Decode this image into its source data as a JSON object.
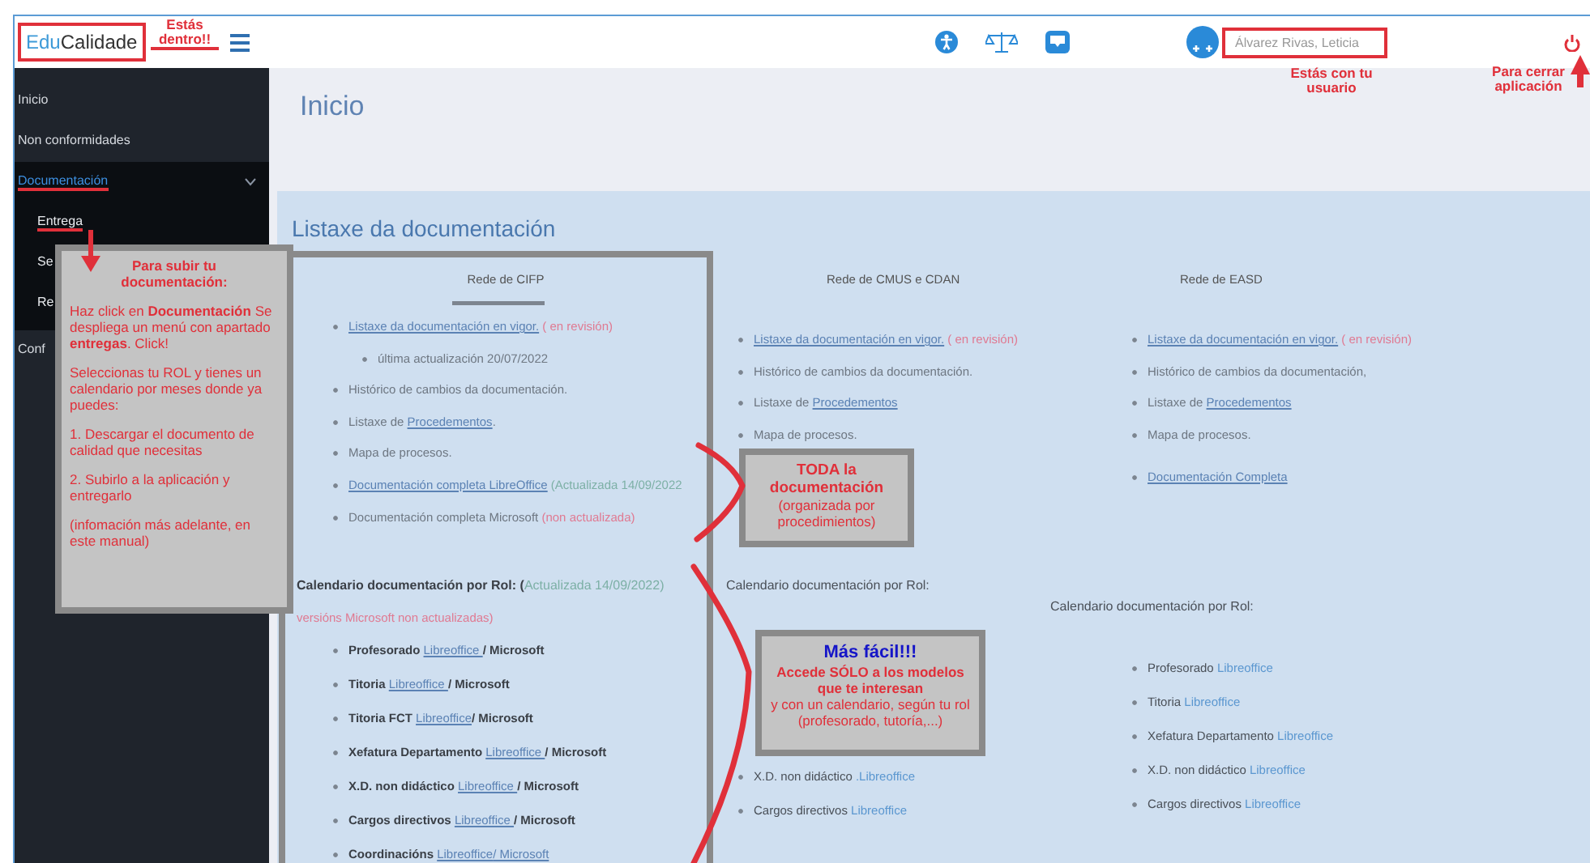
{
  "header": {
    "logo": {
      "part_1": "Edu",
      "part_2": "Calidade",
      "highlighted": true
    },
    "user_name": {
      "value": "Álvarez Rivas, Leticia",
      "highlighted": true
    }
  },
  "sidebar": {
    "items": [
      {
        "label": "Inicio",
        "selected": false,
        "marked": false
      },
      {
        "label": "Non conformidades",
        "selected": false,
        "marked": false
      },
      {
        "label": "Documentación",
        "selected": true,
        "marked": true,
        "expanded": true,
        "children": [
          {
            "label": "Entrega",
            "marked": true
          },
          {
            "label": "Se",
            "marked": false
          },
          {
            "label": "Re",
            "marked": false
          }
        ]
      },
      {
        "label": "Conf",
        "selected": false,
        "marked": false
      }
    ]
  },
  "page_title": "Inicio",
  "panel": {
    "title": "Listaxe da documentación",
    "columns": [
      {
        "heading": "Rede de CIFP",
        "items": [
          {
            "parts": [
              {
                "kind": "link",
                "text": "Listaxe da documentación en vigor."
              },
              {
                "kind": "note",
                "text": " ( en revisión)"
              }
            ],
            "children": [
              {
                "parts": [
                  {
                    "kind": "text",
                    "text": "última actualización 20/07/2022"
                  }
                ]
              }
            ]
          },
          {
            "parts": [
              {
                "kind": "text",
                "text": "Histórico de cambios da documentación."
              }
            ]
          },
          {
            "parts": [
              {
                "kind": "text",
                "text": "Listaxe de "
              },
              {
                "kind": "link",
                "text": "Procedementos"
              },
              {
                "kind": "text",
                "text": "."
              }
            ]
          },
          {
            "parts": [
              {
                "kind": "text",
                "text": "Mapa de procesos."
              }
            ]
          },
          {
            "parts": [
              {
                "kind": "link",
                "text": "Documentación completa LibreOffice"
              },
              {
                "kind": "update",
                "text": " (Actualizada 14/09/2022"
              }
            ]
          },
          {
            "parts": [
              {
                "kind": "text",
                "text": "Documentación completa Microsoft "
              },
              {
                "kind": "note",
                "text": "(non actualizada)"
              }
            ]
          }
        ],
        "calendar": {
          "heading": [
            {
              "kind": "strong",
              "text": "Calendario documentación por Rol: ("
            },
            {
              "kind": "update",
              "text": "Actualizada 14/09/2022)"
            }
          ],
          "note": "versións Microsoft non actualizadas)",
          "items": [
            {
              "parts": [
                {
                  "kind": "strong",
                  "text": "Profesorado "
                },
                {
                  "kind": "link",
                  "text": "Libreoffice "
                },
                {
                  "kind": "strong",
                  "text": " / Microsoft"
                }
              ]
            },
            {
              "parts": [
                {
                  "kind": "strong",
                  "text": "Titoria "
                },
                {
                  "kind": "link",
                  "text": "Libreoffice "
                },
                {
                  "kind": "strong",
                  "text": "/ Microsoft"
                }
              ]
            },
            {
              "parts": [
                {
                  "kind": "strong",
                  "text": "Titoria FCT "
                },
                {
                  "kind": "link",
                  "text": "Libreoffice"
                },
                {
                  "kind": "strong",
                  "text": "/ Microsoft"
                }
              ]
            },
            {
              "parts": [
                {
                  "kind": "strong",
                  "text": "Xefatura Departamento "
                },
                {
                  "kind": "link",
                  "text": "Libreoffice "
                },
                {
                  "kind": "strong",
                  "text": "/ Microsoft"
                }
              ]
            },
            {
              "parts": [
                {
                  "kind": "strong",
                  "text": "X.D. non didáctico "
                },
                {
                  "kind": "link",
                  "text": "Libreoffice "
                },
                {
                  "kind": "strong",
                  "text": "/ Microsoft"
                }
              ]
            },
            {
              "parts": [
                {
                  "kind": "strong",
                  "text": "Cargos directivos "
                },
                {
                  "kind": "link",
                  "text": "Libreoffice "
                },
                {
                  "kind": "strong",
                  "text": "/ Microsoft"
                }
              ]
            },
            {
              "parts": [
                {
                  "kind": "strong",
                  "text": "Coordinacións "
                },
                {
                  "kind": "link",
                  "text": "Libreoffice"
                },
                {
                  "kind": "link",
                  "text": "/ Microsoft"
                }
              ]
            }
          ]
        }
      },
      {
        "heading": "Rede de CMUS e CDAN",
        "items": [
          {
            "parts": [
              {
                "kind": "link",
                "text": "Listaxe da documentación en vigor."
              },
              {
                "kind": "note",
                "text": " ( en revisión)"
              }
            ]
          },
          {
            "parts": [
              {
                "kind": "text",
                "text": "Histórico de cambios da documentación."
              }
            ]
          },
          {
            "parts": [
              {
                "kind": "text",
                "text": "Listaxe de "
              },
              {
                "kind": "link",
                "text": "Procedementos"
              }
            ]
          },
          {
            "parts": [
              {
                "kind": "text",
                "text": "Mapa de procesos."
              }
            ]
          }
        ],
        "calendar": {
          "heading": [
            {
              "kind": "plain",
              "text": "Calendario documentación por Rol:"
            }
          ],
          "items": [
            {
              "parts": [
                {
                  "kind": "plain",
                  "text": "X.D. non didáctico "
                },
                {
                  "kind": "ref",
                  "text": ".Libreoffice"
                }
              ]
            },
            {
              "parts": [
                {
                  "kind": "plain",
                  "text": "Cargos directivos "
                },
                {
                  "kind": "ref",
                  "text": "Libreoffice"
                }
              ]
            }
          ]
        }
      },
      {
        "heading": "Rede de EASD",
        "items": [
          {
            "parts": [
              {
                "kind": "link",
                "text": "Listaxe da documentación en vigor."
              },
              {
                "kind": "note",
                "text": " ( en revisión)"
              }
            ]
          },
          {
            "parts": [
              {
                "kind": "text",
                "text": "Histórico de cambios da documentación,"
              }
            ]
          },
          {
            "parts": [
              {
                "kind": "text",
                "text": "Listaxe de "
              },
              {
                "kind": "link",
                "text": "Procedementos"
              }
            ]
          },
          {
            "parts": [
              {
                "kind": "text",
                "text": "Mapa de procesos."
              }
            ]
          }
        ],
        "more_items": [
          {
            "parts": [
              {
                "kind": "link",
                "text": "Documentación Completa"
              }
            ]
          }
        ],
        "calendar": {
          "heading": [
            {
              "kind": "plain",
              "text": "Calendario documentación por Rol:"
            }
          ],
          "items": [
            {
              "parts": [
                {
                  "kind": "plain",
                  "text": "Profesorado "
                },
                {
                  "kind": "ref",
                  "text": "Libreoffice"
                }
              ]
            },
            {
              "parts": [
                {
                  "kind": "plain",
                  "text": "Titoria "
                },
                {
                  "kind": "ref",
                  "text": "Libreoffice"
                }
              ]
            },
            {
              "parts": [
                {
                  "kind": "plain",
                  "text": "Xefatura Departamento "
                },
                {
                  "kind": "ref",
                  "text": "Libreoffice"
                }
              ]
            },
            {
              "parts": [
                {
                  "kind": "plain",
                  "text": "X.D. non didáctico "
                },
                {
                  "kind": "ref",
                  "text": "Libreoffice"
                }
              ]
            },
            {
              "parts": [
                {
                  "kind": "plain",
                  "text": "Cargos directivos "
                },
                {
                  "kind": "ref",
                  "text": "Libreoffice"
                }
              ]
            }
          ]
        }
      }
    ]
  },
  "annotations": [
    {
      "kind": "frame"
    },
    {
      "kind": "label",
      "text": "Estás dentro!!"
    },
    {
      "kind": "label",
      "text": "Estás con tu usuario"
    },
    {
      "kind": "label",
      "text": "Para cerrar aplicación"
    },
    {
      "kind": "callout",
      "lines": [
        {
          "kind": "heading",
          "text": "Para subir tu documentación:"
        },
        {
          "kind": "body",
          "text": "Haz click en **Documentación** Se despliega un menú con apartado **entregas**. Click!"
        },
        {
          "kind": "body",
          "text": "Seleccionas tu ROL y tienes un calendario por meses donde ya puedes:"
        },
        {
          "kind": "body",
          "text": "1. Descargar el documento de calidad que necesitas"
        },
        {
          "kind": "body",
          "text": "2. Subirlo a la aplicación y entregarlo"
        },
        {
          "kind": "body",
          "text": "(infomación más adelante, en este manual)"
        }
      ]
    },
    {
      "kind": "callout",
      "lines": [
        {
          "kind": "heading",
          "text": "TODA la documentación"
        },
        {
          "kind": "body",
          "text": "(organizada por procedimientos)"
        }
      ]
    },
    {
      "kind": "callout",
      "lines": [
        {
          "kind": "title",
          "text": "Más fácil!!!"
        },
        {
          "kind": "heading",
          "text": "Accede **SÓLO** a los modelos que te interesan"
        },
        {
          "kind": "body",
          "text": "y con un calendario, según tu rol (profesorado, tutoría,...)"
        }
      ]
    }
  ]
}
